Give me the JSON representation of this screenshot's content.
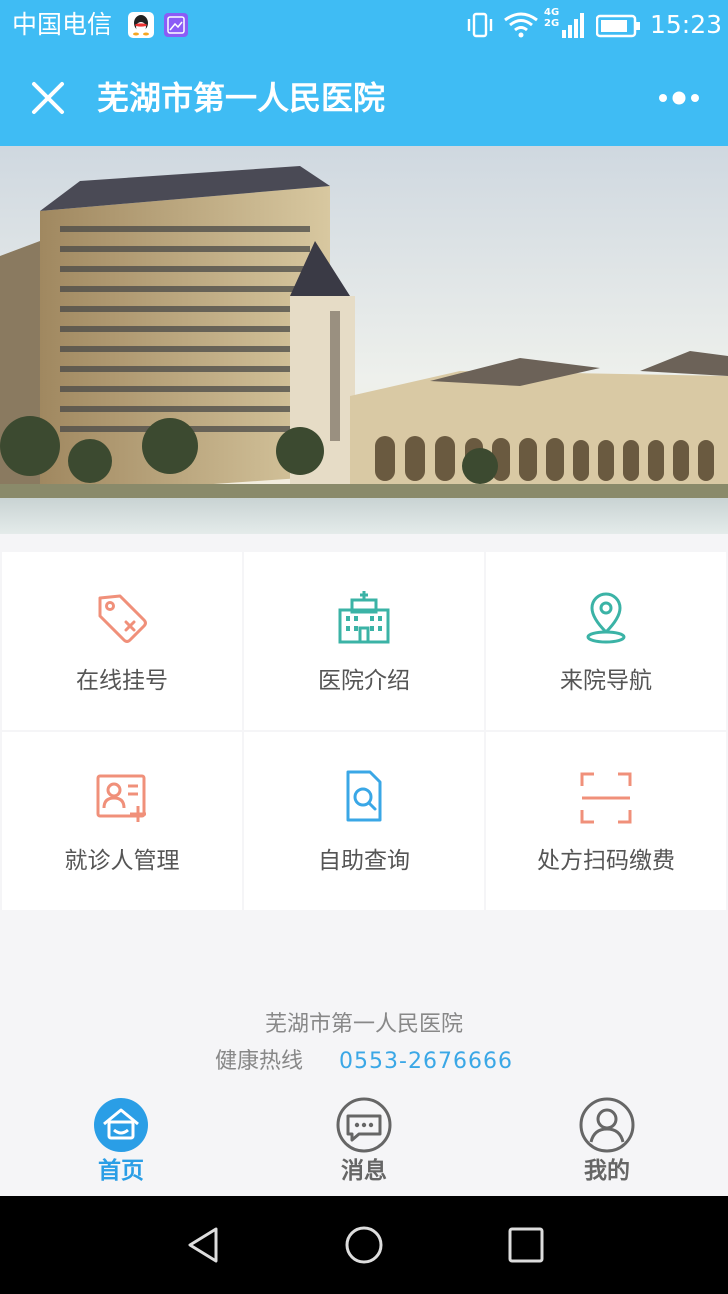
{
  "status_bar": {
    "carrier": "中国电信",
    "network": "4G\n2G",
    "time": "15:23",
    "icons": [
      "qq-icon",
      "image-icon",
      "vibrate-icon",
      "wifi-icon",
      "signal-icon",
      "battery-icon"
    ]
  },
  "title_bar": {
    "title": "芜湖市第一人民医院",
    "close_icon": "close-icon",
    "more_icon": "more-icon"
  },
  "banner": {
    "image": "hospital-building-photo"
  },
  "menu": [
    {
      "label": "在线挂号",
      "icon": "tag-icon"
    },
    {
      "label": "医院介绍",
      "icon": "hospital-icon"
    },
    {
      "label": "来院导航",
      "icon": "location-pin-icon"
    },
    {
      "label": "就诊人管理",
      "icon": "patient-card-icon"
    },
    {
      "label": "自助查询",
      "icon": "document-search-icon"
    },
    {
      "label": "处方扫码缴费",
      "icon": "scan-icon"
    }
  ],
  "footer": {
    "hospital_name": "芜湖市第一人民医院",
    "hotline_label": "健康热线",
    "hotline_number": "0553-2676666"
  },
  "tabs": [
    {
      "label": "首页",
      "icon": "home-icon",
      "active": true
    },
    {
      "label": "消息",
      "icon": "message-icon",
      "active": false
    },
    {
      "label": "我的",
      "icon": "user-icon",
      "active": false
    }
  ],
  "colors": {
    "primary": "#3fbcf4",
    "active_tab": "#2a9ee6",
    "icon_salmon": "#f0907a",
    "icon_teal": "#3bb3a6",
    "icon_blue": "#3aa7e6"
  }
}
